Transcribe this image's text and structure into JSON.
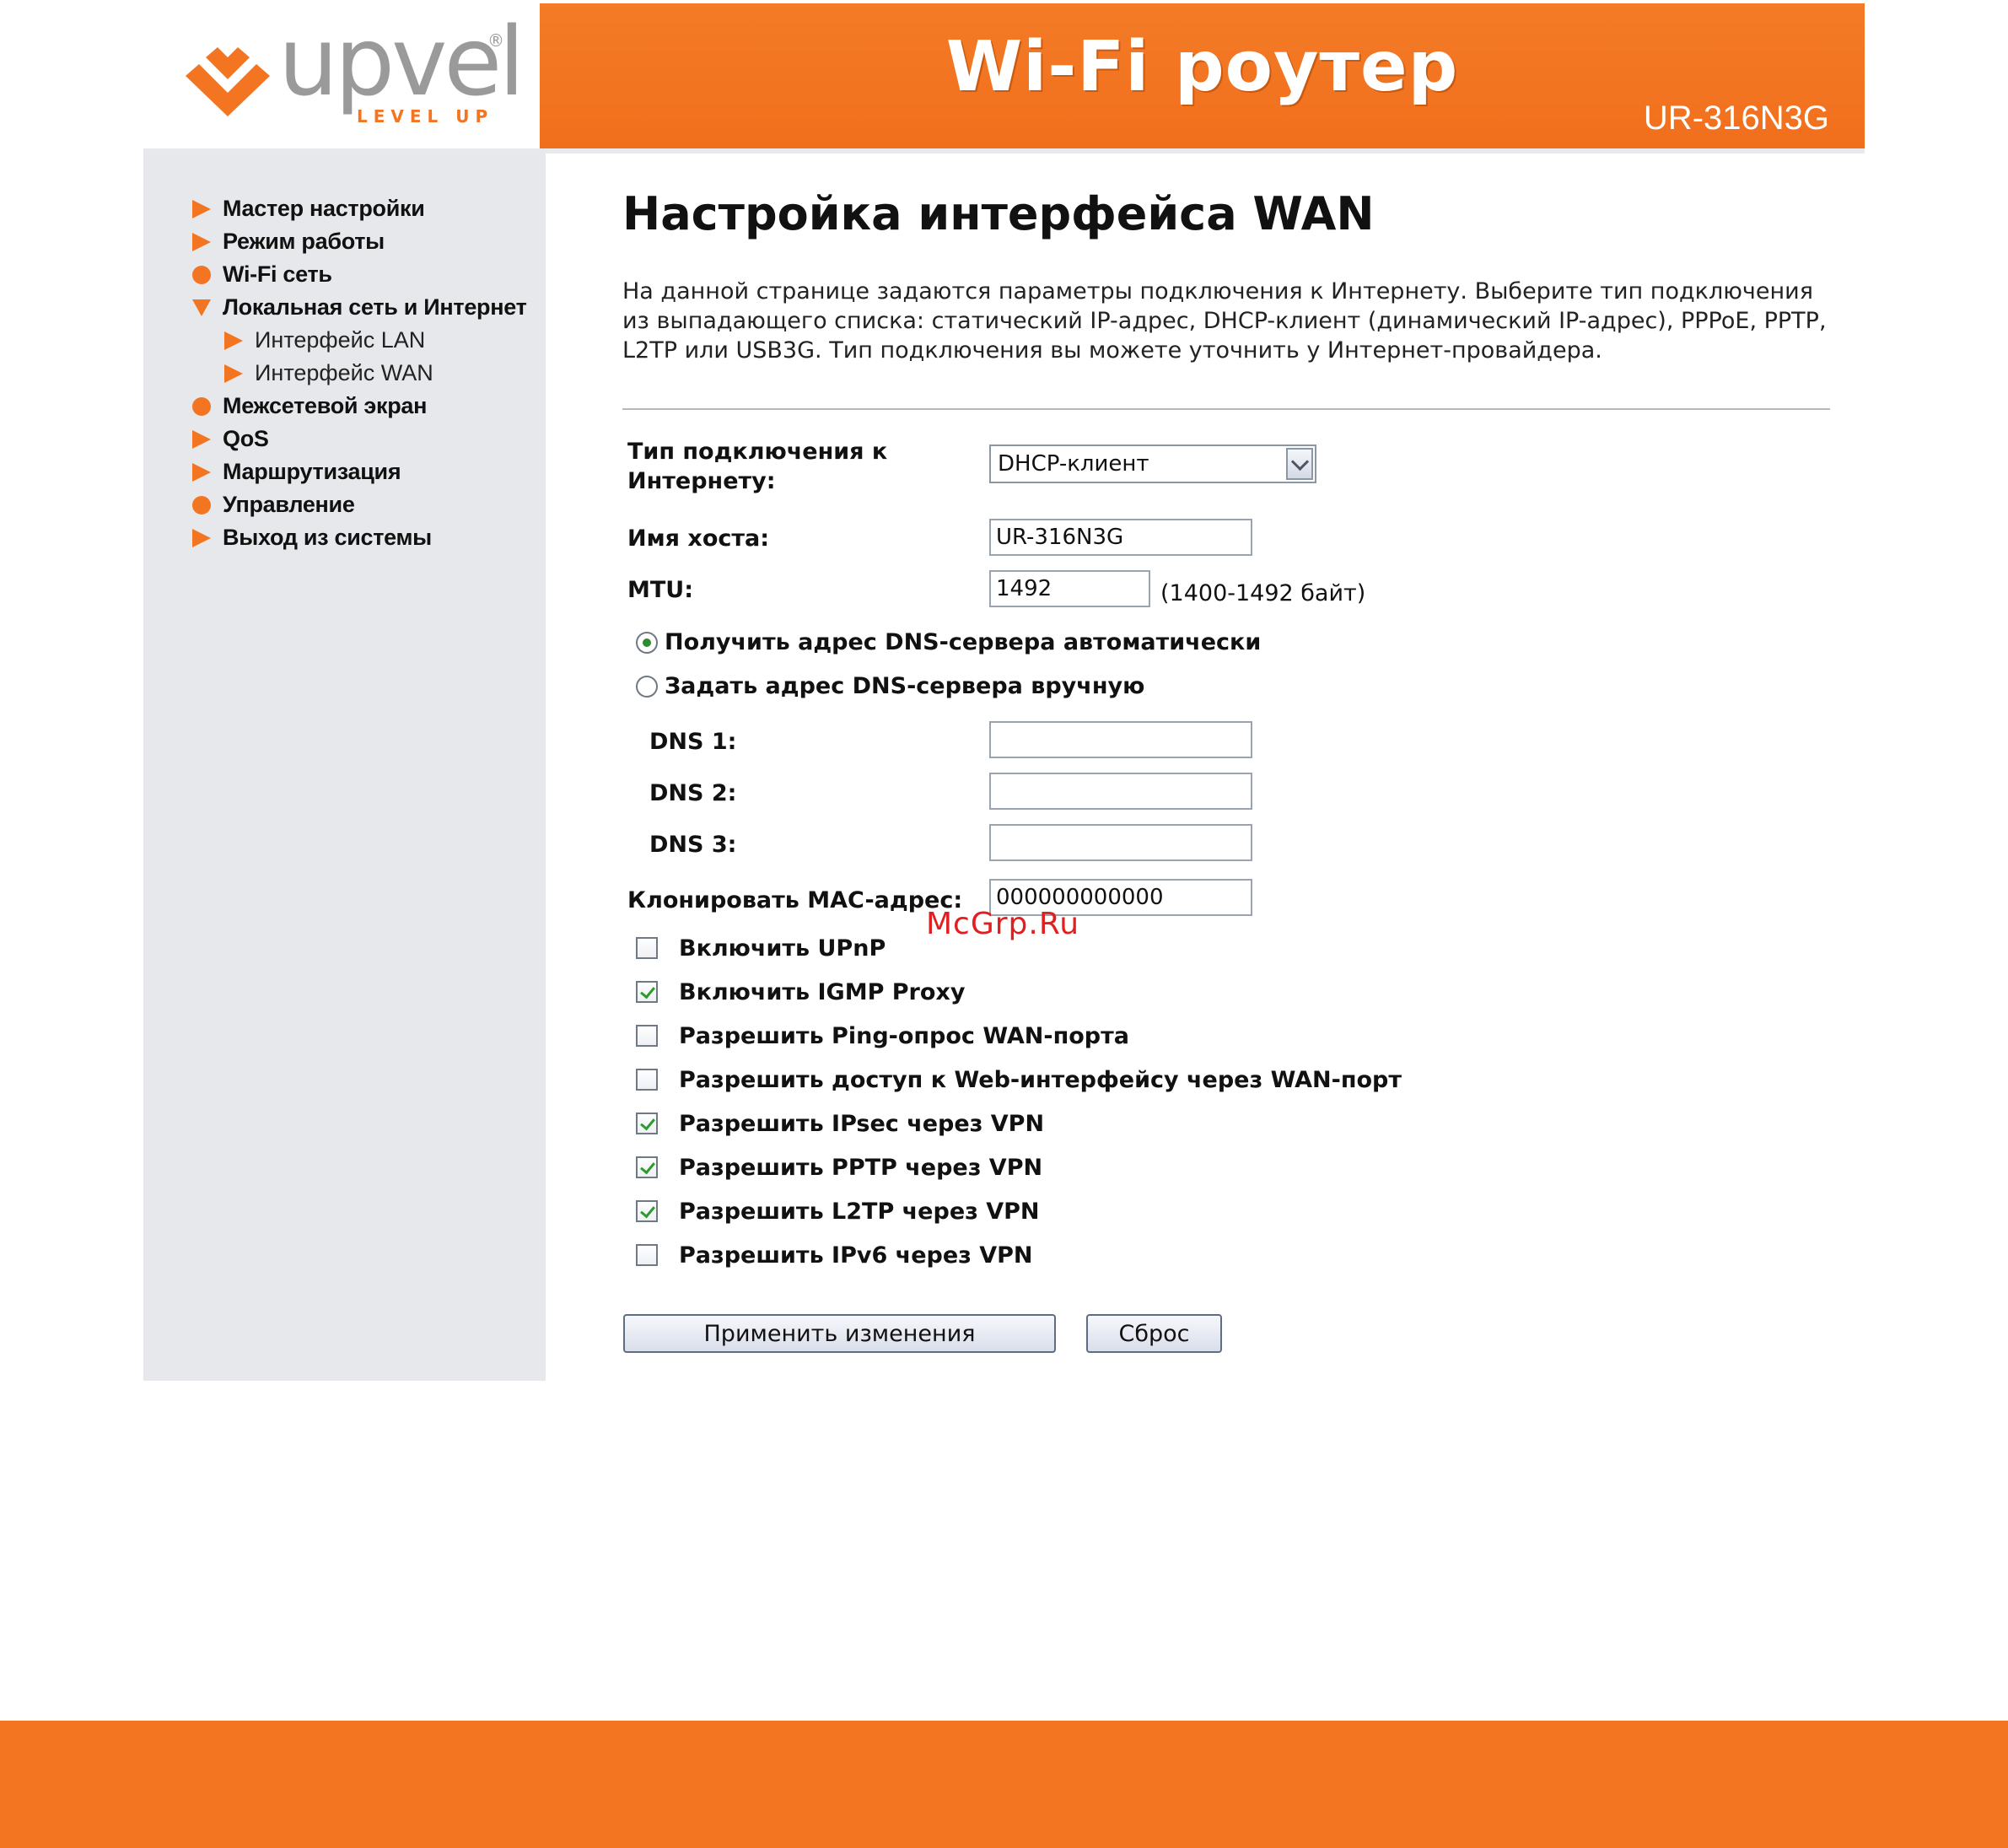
{
  "header": {
    "brand": "upvel",
    "brand_tagline": "LEVEL UP",
    "brand_mark": "®",
    "banner_title": "Wi-Fi роутер",
    "model": "UR-316N3G",
    "brand_color": "#f37521"
  },
  "sidebar": {
    "items": [
      {
        "label": "Мастер настройки",
        "marker": "triangle-right"
      },
      {
        "label": "Режим работы",
        "marker": "triangle-right"
      },
      {
        "label": "Wi-Fi сеть",
        "marker": "dot"
      },
      {
        "label": "Локальная сеть и Интернет",
        "marker": "triangle-down"
      },
      {
        "label": "Интерфейс LAN",
        "marker": "triangle-right"
      },
      {
        "label": "Интерфейс WAN",
        "marker": "triangle-right"
      },
      {
        "label": "Межсетевой экран",
        "marker": "dot"
      },
      {
        "label": "QoS",
        "marker": "triangle-right"
      },
      {
        "label": "Маршрутизация",
        "marker": "triangle-right"
      },
      {
        "label": "Управление",
        "marker": "dot"
      },
      {
        "label": "Выход из системы",
        "marker": "triangle-right"
      }
    ]
  },
  "main": {
    "title": "Настройка интерфейса WAN",
    "intro": "На данной странице задаются параметры подключения к Интернету. Выберите тип подключения из выпадающего списка: статический IP-адрес, DHCP-клиент (динамический IP-адрес), PPPoE, PPTP, L2TP или USB3G. Тип подключения вы можете уточнить у Интернет-провайдера.",
    "connection_type": {
      "label": "Тип подключения к Интернету:",
      "value": "DHCP-клиент"
    },
    "hostname": {
      "label": "Имя хоста:",
      "value": "UR-316N3G"
    },
    "mtu": {
      "label": "MTU:",
      "value": "1492",
      "hint": "(1400-1492 байт)"
    },
    "dns_auto": {
      "label": "Получить адрес DNS-сервера автоматически",
      "selected": true
    },
    "dns_manual": {
      "label": "Задать адрес DNS-сервера вручную",
      "selected": false
    },
    "dns1": {
      "label": "DNS 1:",
      "value": ""
    },
    "dns2": {
      "label": "DNS 2:",
      "value": ""
    },
    "dns3": {
      "label": "DNS 3:",
      "value": ""
    },
    "clone_mac": {
      "label": "Клонировать MAC-адрес:",
      "value": "000000000000"
    },
    "options": [
      {
        "label": "Включить UPnP",
        "checked": false
      },
      {
        "label": "Включить IGMP Proxy",
        "checked": true
      },
      {
        "label": "Разрешить Ping-опрос WAN-порта",
        "checked": false
      },
      {
        "label": "Разрешить доступ к Web-интерфейсу через WAN-порт",
        "checked": false
      },
      {
        "label": "Разрешить IPsec через VPN",
        "checked": true
      },
      {
        "label": "Разрешить PPTP через VPN",
        "checked": true
      },
      {
        "label": "Разрешить L2TP через VPN",
        "checked": true
      },
      {
        "label": "Разрешить IPv6 через VPN",
        "checked": false
      }
    ],
    "apply_label": "Применить изменения",
    "reset_label": "Сброс"
  },
  "watermark": "McGrp.Ru"
}
